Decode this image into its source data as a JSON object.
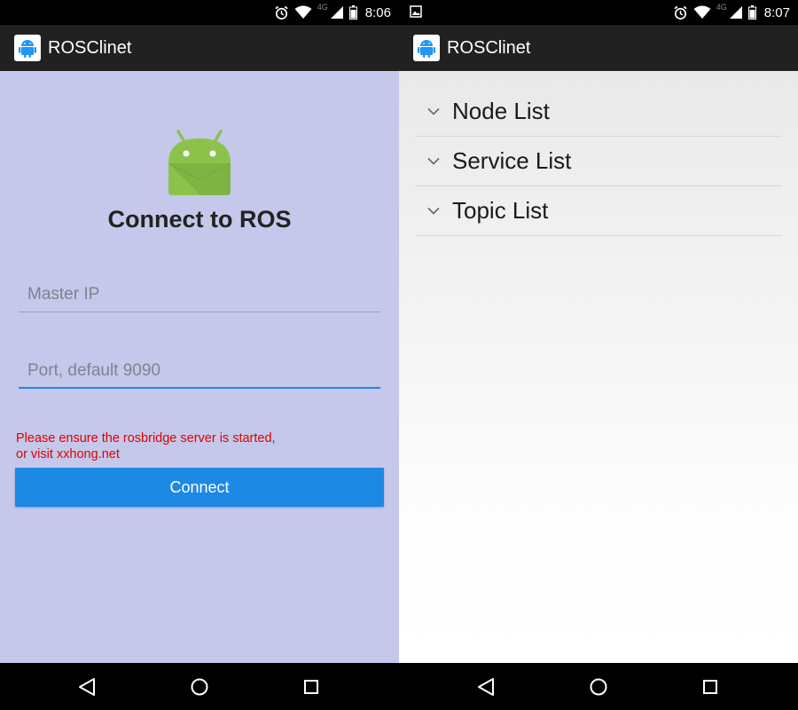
{
  "left_screen": {
    "status_bar": {
      "network": "4G",
      "time": "8:06",
      "icons": [
        "alarm-icon",
        "wifi-icon",
        "signal-icon",
        "battery-icon"
      ]
    },
    "app_bar": {
      "title": "ROSClinet",
      "icon": "android-app-icon"
    },
    "main": {
      "logo": "android-logo-icon",
      "title": "Connect to ROS",
      "master_ip": {
        "value": "",
        "placeholder": "Master IP"
      },
      "port": {
        "value": "",
        "placeholder": "Port, default 9090"
      },
      "hint_line1": "Please ensure the rosbridge server is started,",
      "hint_line2": "or visit xxhong.net",
      "connect_label": "Connect"
    },
    "nav_bar": {
      "buttons": [
        "back-icon",
        "home-icon",
        "recent-apps-icon"
      ]
    }
  },
  "right_screen": {
    "status_bar": {
      "network": "4G",
      "time": "8:07",
      "icons": [
        "image-notification-icon",
        "alarm-icon",
        "wifi-icon",
        "signal-icon",
        "battery-icon"
      ]
    },
    "app_bar": {
      "title": "ROSClinet",
      "icon": "android-app-icon"
    },
    "list": {
      "items": [
        {
          "label": "Node List",
          "icon": "chevron-down-icon"
        },
        {
          "label": "Service List",
          "icon": "chevron-down-icon"
        },
        {
          "label": "Topic List",
          "icon": "chevron-down-icon"
        }
      ]
    },
    "nav_bar": {
      "buttons": [
        "back-icon",
        "home-icon",
        "recent-apps-icon"
      ]
    }
  },
  "colors": {
    "login_background": "#c5c8ea",
    "accent": "#1e88e5",
    "hint_text": "#e00000",
    "app_bar": "#212121",
    "android_green": "#8bc34a"
  }
}
